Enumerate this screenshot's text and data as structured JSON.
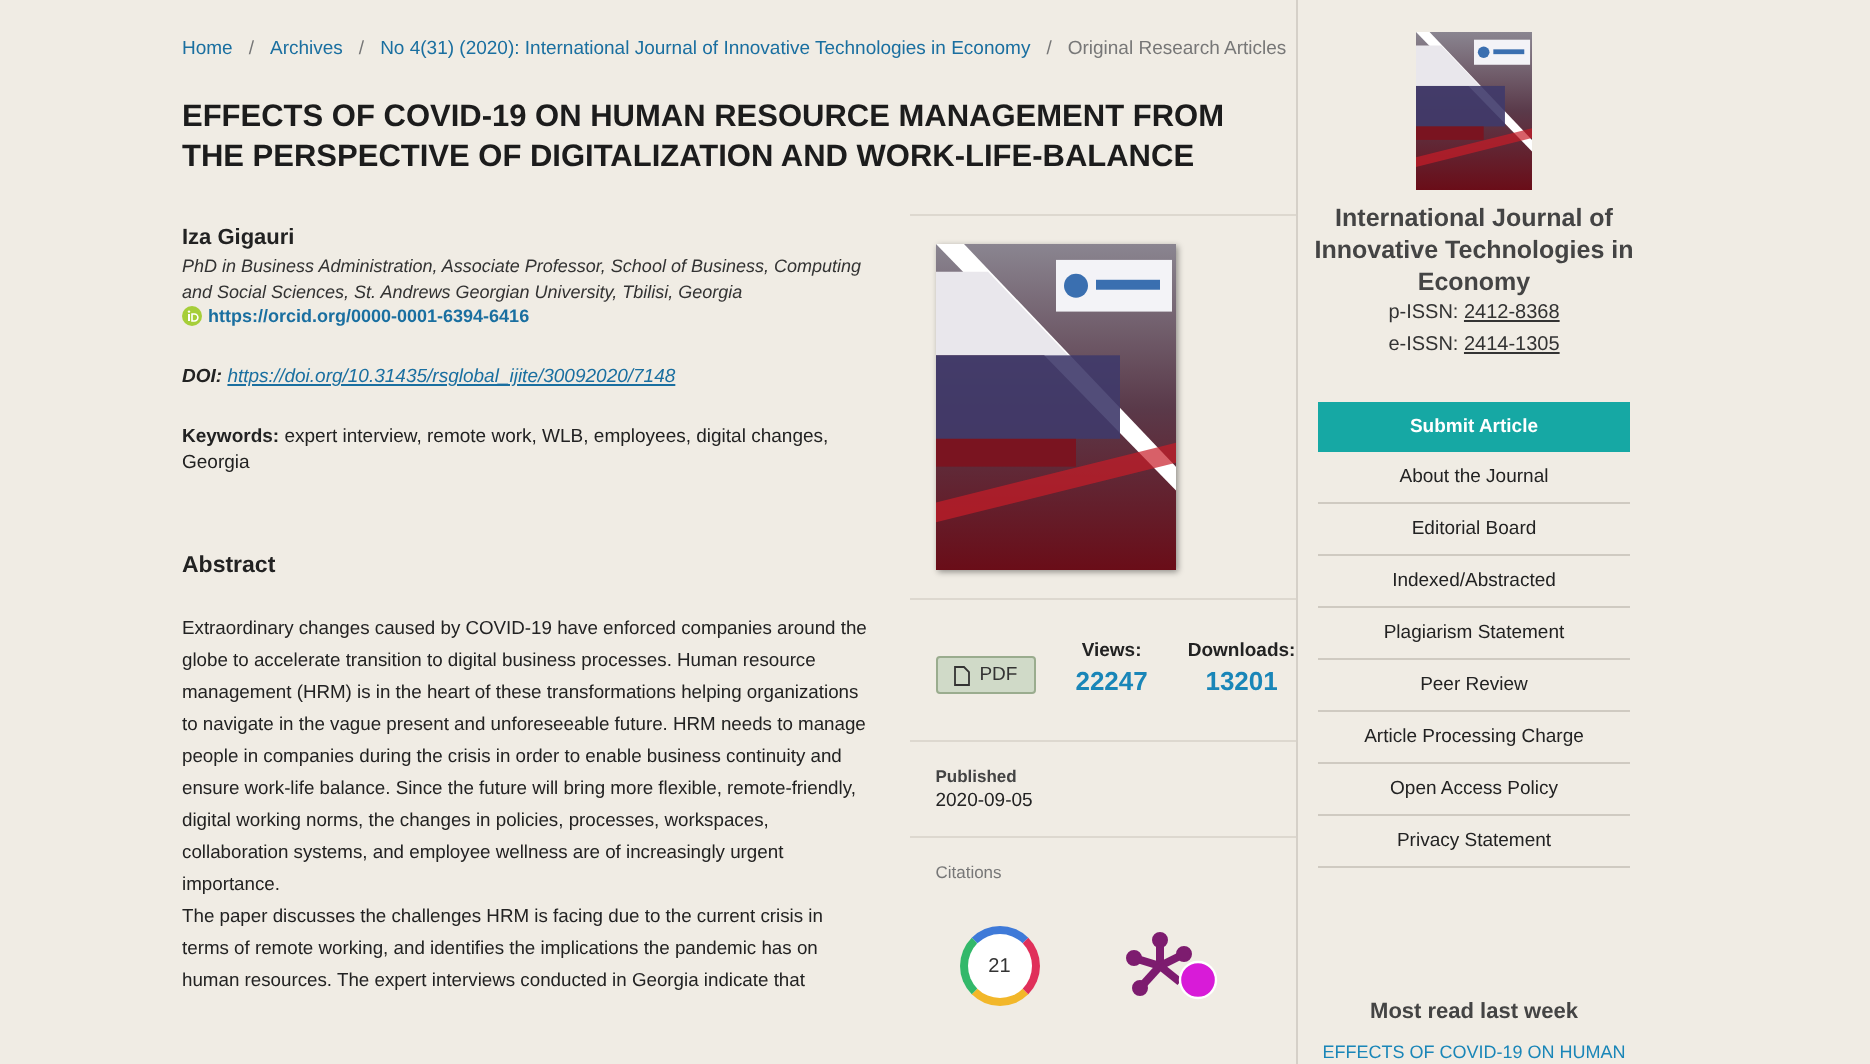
{
  "breadcrumb_separator": "/",
  "breadcrumbs": [
    {
      "label": "Home",
      "link": true
    },
    {
      "label": "Archives",
      "link": true
    },
    {
      "label": "No 4(31) (2020): International Journal of Innovative Technologies in Economy",
      "link": true
    },
    {
      "label": "Original Research Articles",
      "link": false
    }
  ],
  "article": {
    "title": "EFFECTS OF COVID-19 ON HUMAN RESOURCE MANAGEMENT FROM THE PERSPECTIVE OF DIGITALIZATION AND WORK-LIFE-BALANCE",
    "author": {
      "name": "Iza Gigauri",
      "affiliation": "PhD in Business Administration, Associate Professor, School of Business, Computing and Social Sciences, St. Andrews Georgian University, Tbilisi, Georgia",
      "orcid": "https://orcid.org/0000-0001-6394-6416"
    },
    "doi": {
      "label": "DOI:",
      "url": "https://doi.org/10.31435/rsglobal_ijite/30092020/7148"
    },
    "keywords": {
      "label": "Keywords:",
      "text": "expert interview, remote work, WLB, employees, digital changes, Georgia"
    },
    "abstract": {
      "heading": "Abstract",
      "paragraphs": [
        "Extraordinary changes caused by COVID-19 have enforced companies around the globe to accelerate transition to digital business processes. Human resource management (HRM) is in the heart of these transformations helping organizations to navigate in the vague present and unforeseeable future. HRM needs to manage people in companies during the crisis in order to enable business continuity and ensure work-life balance. Since the future will bring more flexible, remote-friendly, digital working norms, the changes in policies, processes, workspaces, collaboration systems, and employee wellness are of increasingly urgent importance.",
        "The paper discusses the challenges HRM is facing due to the current crisis in terms of remote working, and identifies the implications the pandemic has on human resources. The expert interviews conducted in Georgia indicate that"
      ]
    }
  },
  "details": {
    "pdf": "PDF",
    "stats": [
      {
        "label": "Views:",
        "value": "22247"
      },
      {
        "label": "Downloads:",
        "value": "13201"
      }
    ],
    "published": {
      "label": "Published",
      "date": "2020-09-05"
    },
    "citations": {
      "label": "Citations",
      "count": "21"
    }
  },
  "sidebar": {
    "journal_title": "International Journal of Innovative Technologies in Economy",
    "issn": [
      {
        "label": "p-ISSN:",
        "value": "2412-8368"
      },
      {
        "label": "e-ISSN:",
        "value": "2414-1305"
      }
    ],
    "menu": [
      {
        "label": "Submit Article",
        "kind": "primary"
      },
      {
        "label": "About the Journal",
        "kind": "link"
      },
      {
        "label": "Editorial Board",
        "kind": "link"
      },
      {
        "label": "Indexed/Abstracted",
        "kind": "link"
      },
      {
        "label": "Plagiarism Statement",
        "kind": "link"
      },
      {
        "label": "Peer Review",
        "kind": "link"
      },
      {
        "label": "Article Processing Charge",
        "kind": "link"
      },
      {
        "label": "Open Access Policy",
        "kind": "link"
      },
      {
        "label": "Privacy Statement",
        "kind": "link"
      }
    ],
    "most_read": {
      "heading": "Most read last week",
      "items": [
        "EFFECTS OF COVID-19 ON HUMAN"
      ]
    }
  }
}
